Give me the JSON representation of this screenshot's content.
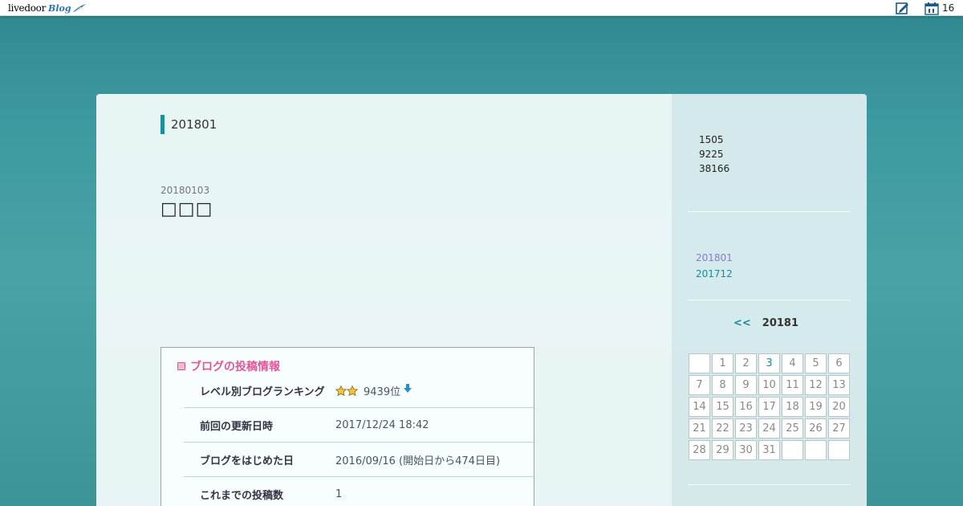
{
  "topbar": {
    "logo_livedoor": "livedoor",
    "logo_blog": "Blog",
    "notification_count": "16"
  },
  "main": {
    "archive_heading": "201801",
    "post": {
      "date": "20180103",
      "title": "□□□"
    },
    "info_box": {
      "title": "ブログの投稿情報",
      "rows": [
        {
          "label": "レベル別ブログランキング",
          "value": "9439位"
        },
        {
          "label": "前回の更新日時",
          "value": "2017/12/24 18:42"
        },
        {
          "label": "ブログをはじめた日",
          "value": "2016/09/16 (開始日から474日目)"
        },
        {
          "label": "これまでの投稿数",
          "value": "1"
        }
      ]
    }
  },
  "sidebar": {
    "counts": [
      "1505",
      "9225",
      "38166"
    ],
    "archives": [
      {
        "label": "201801",
        "visited": true
      },
      {
        "label": "201712",
        "visited": false
      }
    ],
    "calendar": {
      "prev": "<<",
      "month": "20181",
      "weeks": [
        [
          "",
          "1",
          "2",
          "3",
          "4",
          "5",
          "6"
        ],
        [
          "7",
          "8",
          "9",
          "10",
          "11",
          "12",
          "13"
        ],
        [
          "14",
          "15",
          "16",
          "17",
          "18",
          "19",
          "20"
        ],
        [
          "21",
          "22",
          "23",
          "24",
          "25",
          "26",
          "27"
        ],
        [
          "28",
          "29",
          "30",
          "31",
          "",
          "",
          ""
        ]
      ],
      "linked_day": "3"
    }
  },
  "colors": {
    "accent": "#1e8e9a",
    "pink": "#e0589a",
    "visited_link": "#8a78d2"
  }
}
